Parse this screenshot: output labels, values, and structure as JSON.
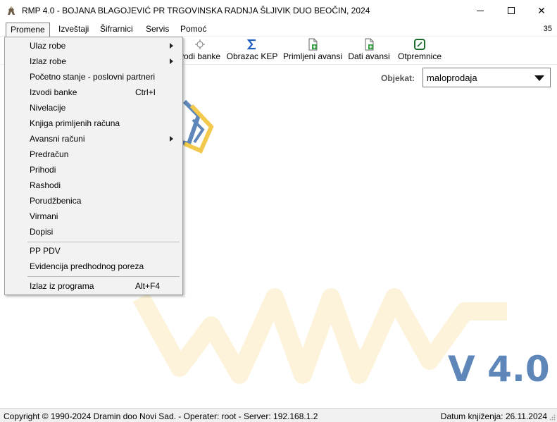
{
  "window": {
    "title": "RMP 4.0 - BOJANA BLAGOJEVIĆ PR TRGOVINSKA RADNJA ŠLJIVIK DUO BEOČIN, 2024",
    "icon": "app-logo-icon",
    "minimize_glyph": "",
    "maximize_glyph": "",
    "close_glyph": "✕"
  },
  "menubar": {
    "items": [
      {
        "label": "Promene",
        "active": true
      },
      {
        "label": "Izveštaji"
      },
      {
        "label": "Šifrarnici"
      },
      {
        "label": "Servis"
      },
      {
        "label": "Pomoć"
      }
    ],
    "count": "35"
  },
  "toolbar": {
    "items": [
      {
        "label": "vodi banke",
        "icon": "bank-statement-icon"
      },
      {
        "label": "Obrazac KEP",
        "icon": "sigma-icon"
      },
      {
        "label": "Primljeni avansi",
        "icon": "document-add-icon"
      },
      {
        "label": "Dati avansi",
        "icon": "document-add-icon"
      },
      {
        "label": "Otpremnice",
        "icon": "delivery-note-icon"
      }
    ]
  },
  "object": {
    "label": "Objekat:",
    "value": "maloprodaja"
  },
  "dropdown": {
    "items": [
      {
        "label": "Ulaz robe",
        "submenu": true
      },
      {
        "label": "Izlaz robe",
        "submenu": true
      },
      {
        "label": "Početno stanje - poslovni partneri"
      },
      {
        "label": "Izvodi banke",
        "shortcut": "Ctrl+I"
      },
      {
        "label": "Nivelacije"
      },
      {
        "label": "Knjiga primljenih računa"
      },
      {
        "label": "Avansni računi",
        "submenu": true
      },
      {
        "label": "Predračun"
      },
      {
        "label": "Prihodi"
      },
      {
        "label": "Rashodi"
      },
      {
        "label": "Porudžbenica"
      },
      {
        "label": "Virmani"
      },
      {
        "label": "Dopisi"
      },
      {
        "label": "PP PDV"
      },
      {
        "label": "Evidencija predhodnog poreza"
      },
      {
        "label": "Izlaz iz programa",
        "shortcut": "Alt+F4"
      }
    ]
  },
  "background": {
    "version": "V 4.0",
    "logo_colors": {
      "yellow": "#f2c94c",
      "blue": "#5e86b8"
    }
  },
  "statusbar": {
    "left": "Copyright © 1990-2024 Dramin doo Novi Sad. - Operater: root - Server: 192.168.1.2",
    "right": "Datum knjiženja: 26.11.2024"
  }
}
